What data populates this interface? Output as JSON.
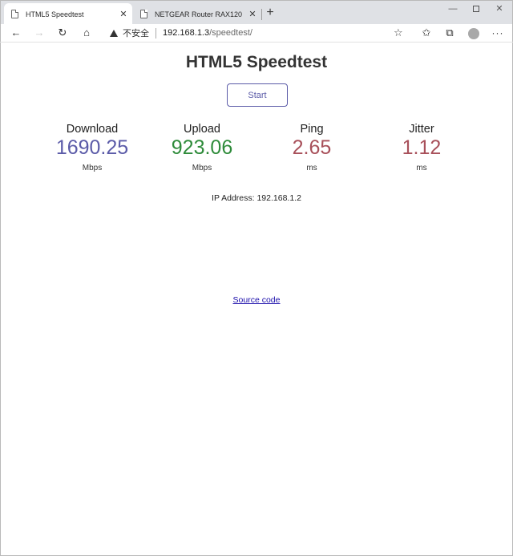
{
  "browser": {
    "tabs": [
      {
        "title": "HTML5 Speedtest",
        "active": true
      },
      {
        "title": "NETGEAR Router RAX120",
        "active": false
      }
    ],
    "address": {
      "security_label": "不安全",
      "host": "192.168.1.3",
      "path": "/speedtest/"
    }
  },
  "page": {
    "title": "HTML5 Speedtest",
    "start_label": "Start",
    "metrics": {
      "download": {
        "label": "Download",
        "value": "1690.25",
        "unit": "Mbps",
        "color": "#5b5ba8"
      },
      "upload": {
        "label": "Upload",
        "value": "923.06",
        "unit": "Mbps",
        "color": "#2e8b3a"
      },
      "ping": {
        "label": "Ping",
        "value": "2.65",
        "unit": "ms",
        "color": "#a8505a"
      },
      "jitter": {
        "label": "Jitter",
        "value": "1.12",
        "unit": "ms",
        "color": "#a8505a"
      }
    },
    "ip_text": "IP Address: 192.168.1.2",
    "source_link": "Source code"
  },
  "colors": {
    "accent": "#5b5ba8",
    "link": "#1a0dab"
  }
}
